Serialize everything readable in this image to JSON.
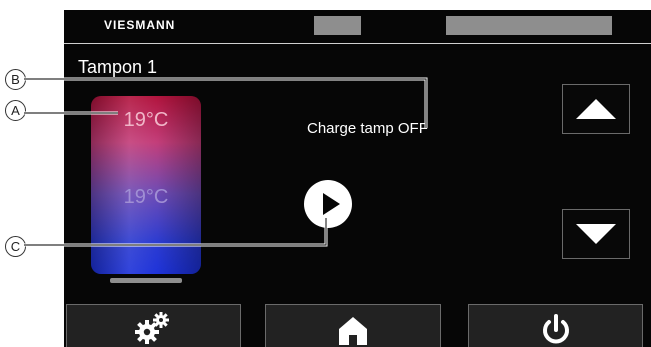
{
  "brand": "VIESMANN",
  "header": {
    "title": "Tampon 1"
  },
  "tank": {
    "temp_top": "19°C",
    "temp_bottom": "19°C"
  },
  "status": "Charge tamp OFF",
  "callouts": [
    "A",
    "B",
    "C"
  ],
  "icons": {
    "play": "play-icon",
    "up": "arrow-up-icon",
    "down": "arrow-down-icon",
    "settings": "gears-icon",
    "home": "home-icon",
    "power": "power-icon"
  },
  "colors": {
    "background": "#060606",
    "tank_top": "#b0103a",
    "tank_bottom": "#1a2fd9",
    "button_border": "#6a6a6a",
    "header_block": "#8e8e8e"
  }
}
